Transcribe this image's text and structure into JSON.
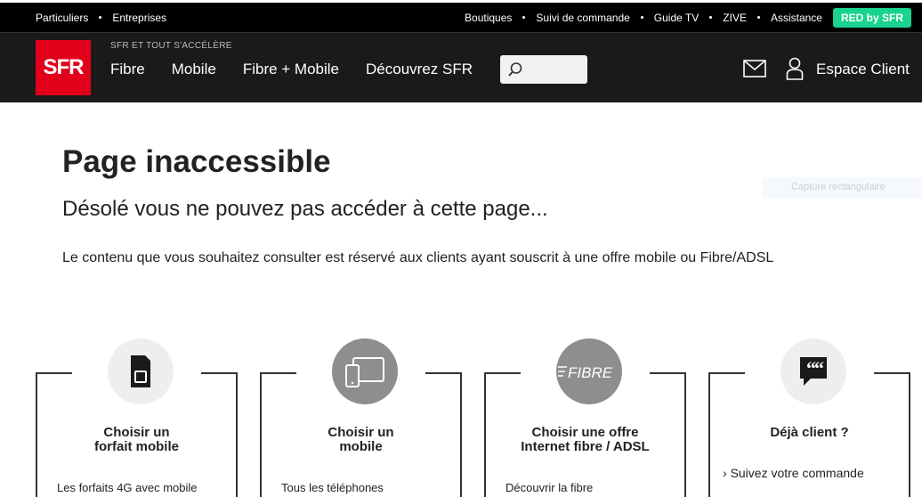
{
  "topbar": {
    "left": [
      "Particuliers",
      "Entreprises"
    ],
    "right": [
      "Boutiques",
      "Suivi de commande",
      "Guide TV",
      "ZIVE",
      "Assistance"
    ],
    "red_button": "RED by SFR",
    "colors": {
      "background": "#000000",
      "red_button": "#19d38f"
    }
  },
  "header": {
    "logo_text": "SFR",
    "tagline": "SFR ET TOUT S'ACCÉLÈRE",
    "menu": [
      "Fibre",
      "Mobile",
      "Fibre + Mobile",
      "Découvrez SFR"
    ],
    "search_placeholder": "",
    "espace_client": "Espace Client",
    "colors": {
      "background": "#1a1a1a",
      "logo": "#e2001a"
    }
  },
  "main": {
    "title": "Page inaccessible",
    "subtitle": "Désolé vous ne pouvez pas accéder à cette page...",
    "description": "Le contenu que vous souhaitez consulter est réservé aux clients ayant souscrit à une offre mobile ou Fibre/ADSL"
  },
  "overlay": {
    "capture_label": "Capture rectangulaire"
  },
  "cards": [
    {
      "title_line1": "Choisir un",
      "title_line2": "forfait mobile",
      "icon": "sim-card-icon",
      "link": "Les forfaits 4G avec mobile"
    },
    {
      "title_line1": "Choisir un",
      "title_line2": "mobile",
      "icon": "devices-icon",
      "link": "Tous les téléphones"
    },
    {
      "title_line1": "Choisir une offre",
      "title_line2": "Internet fibre / ADSL",
      "icon": "fibre-icon",
      "icon_text": "FIBRE",
      "link": "Découvrir la fibre"
    },
    {
      "title_line1": "Déjà client ?",
      "title_line2": "",
      "icon": "quote-bubble-icon",
      "link": "Suivez votre commande"
    }
  ]
}
